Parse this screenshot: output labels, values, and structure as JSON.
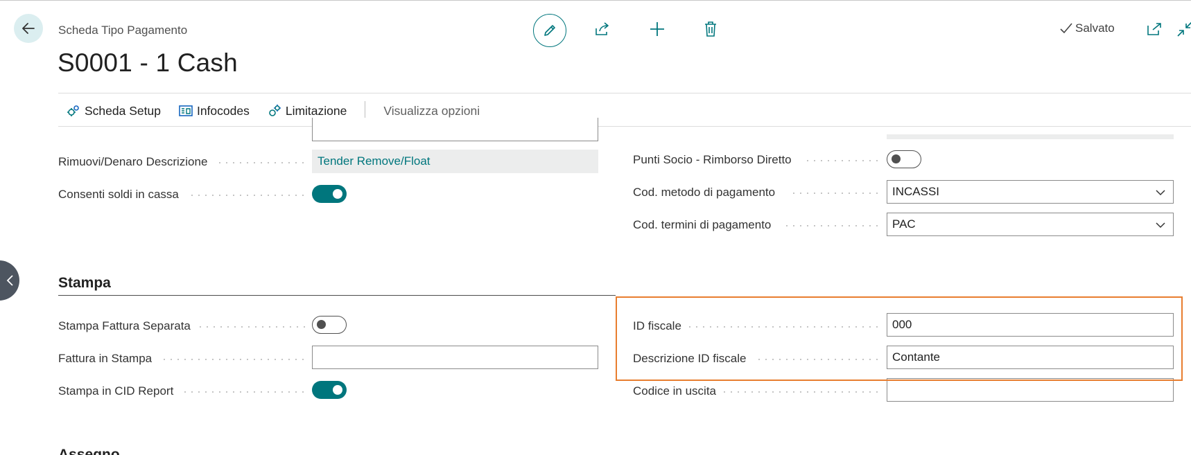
{
  "header": {
    "caption": "Scheda Tipo Pagamento",
    "title": "S0001 - 1 Cash",
    "saved_label": "Salvato"
  },
  "actions": [
    {
      "label": "Scheda Setup",
      "icon": "setup-gears-icon"
    },
    {
      "label": "Infocodes",
      "icon": "infocodes-icon"
    },
    {
      "label": "Limitazione",
      "icon": "limitation-icon"
    },
    {
      "label": "Visualizza opzioni"
    }
  ],
  "fields": {
    "rimuovi_label": "Rimuovi/Denaro Descrizione",
    "rimuovi_value": "Tender Remove/Float",
    "consenti_label": "Consenti soldi in cassa",
    "consenti_on": true,
    "punti_label": "Punti Socio - Rimborso Diretto",
    "punti_on": false,
    "metodo_label": "Cod. metodo di pagamento",
    "metodo_value": "INCASSI",
    "termini_label": "Cod. termini di pagamento",
    "termini_value": "PAC"
  },
  "stampa": {
    "title": "Stampa",
    "fattura_sep_label": "Stampa Fattura Separata",
    "fattura_sep_on": false,
    "fattura_stampa_label": "Fattura in Stampa",
    "fattura_stampa_value": "",
    "cid_label": "Stampa in CID Report",
    "cid_on": true,
    "id_fiscale_label": "ID fiscale",
    "id_fiscale_value": "000",
    "desc_id_label": "Descrizione ID fiscale",
    "desc_id_value": "Contante",
    "codice_uscita_label": "Codice in uscita",
    "codice_uscita_value": ""
  },
  "next_section_title": "Assegno",
  "colors": {
    "accent": "#00767d",
    "highlight": "#e87d2e"
  }
}
